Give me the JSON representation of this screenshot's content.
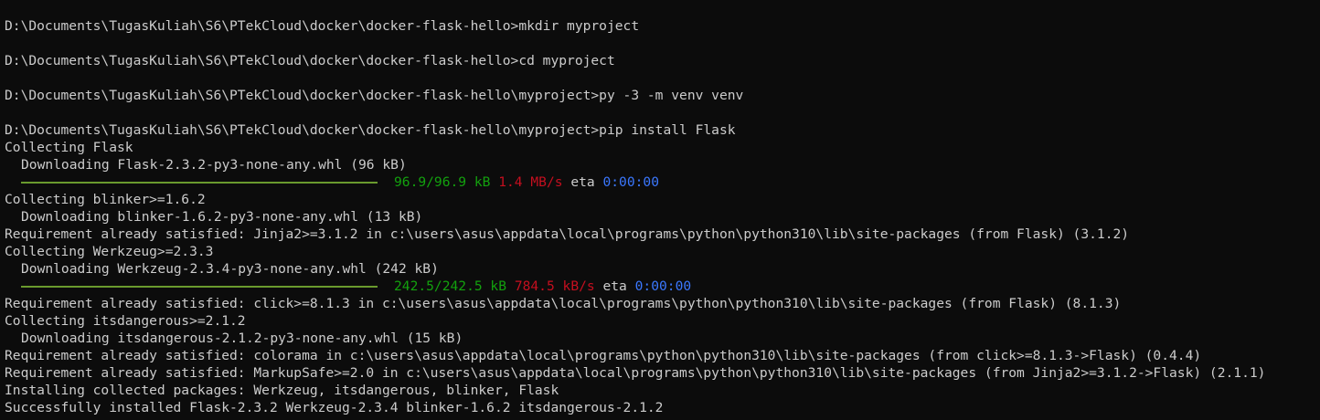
{
  "terminal": {
    "line01": "D:\\Documents\\TugasKuliah\\S6\\PTekCloud\\docker\\docker-flask-hello>mkdir myproject",
    "line03": "D:\\Documents\\TugasKuliah\\S6\\PTekCloud\\docker\\docker-flask-hello>cd myproject",
    "line05": "D:\\Documents\\TugasKuliah\\S6\\PTekCloud\\docker\\docker-flask-hello\\myproject>py -3 -m venv venv",
    "line07": "D:\\Documents\\TugasKuliah\\S6\\PTekCloud\\docker\\docker-flask-hello\\myproject>pip install Flask",
    "line08": "Collecting Flask",
    "line09": "Downloading Flask-2.3.2-py3-none-any.whl (96 kB)",
    "progress1": {
      "size": "96.9/96.9 kB",
      "speed": "1.4 MB/s",
      "eta_label": "eta",
      "eta": "0:00:00",
      "fraction": 1.0
    },
    "line11": "Collecting blinker>=1.6.2",
    "line12": "Downloading blinker-1.6.2-py3-none-any.whl (13 kB)",
    "line13": "Requirement already satisfied: Jinja2>=3.1.2 in c:\\users\\asus\\appdata\\local\\programs\\python\\python310\\lib\\site-packages (from Flask) (3.1.2)",
    "line14": "Collecting Werkzeug>=2.3.3",
    "line15": "Downloading Werkzeug-2.3.4-py3-none-any.whl (242 kB)",
    "progress2": {
      "size": "242.5/242.5 kB",
      "speed": "784.5 kB/s",
      "eta_label": "eta",
      "eta": "0:00:00",
      "fraction": 1.0
    },
    "line17": "Requirement already satisfied: click>=8.1.3 in c:\\users\\asus\\appdata\\local\\programs\\python\\python310\\lib\\site-packages (from Flask) (8.1.3)",
    "line18": "Collecting itsdangerous>=2.1.2",
    "line19": "Downloading itsdangerous-2.1.2-py3-none-any.whl (15 kB)",
    "line20": "Requirement already satisfied: colorama in c:\\users\\asus\\appdata\\local\\programs\\python\\python310\\lib\\site-packages (from click>=8.1.3->Flask) (0.4.4)",
    "line21": "Requirement already satisfied: MarkupSafe>=2.0 in c:\\users\\asus\\appdata\\local\\programs\\python\\python310\\lib\\site-packages (from Jinja2>=3.1.2->Flask) (2.1.1)",
    "line22": "Installing collected packages: Werkzeug, itsdangerous, blinker, Flask",
    "line23": "Successfully installed Flask-2.3.2 Werkzeug-2.3.4 blinker-1.6.2 itsdangerous-2.1.2"
  },
  "colors": {
    "background": "#0c0c0c",
    "text": "#cccccc",
    "progress_bar": "#6a9a2e",
    "size_text": "#13a10e",
    "speed_text": "#c50f1f",
    "eta_text": "#3b78ff"
  }
}
